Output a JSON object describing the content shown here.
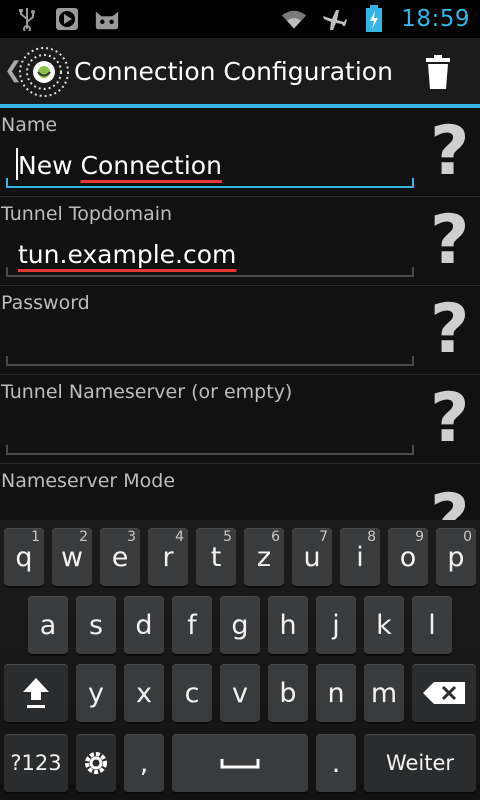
{
  "statusbar": {
    "time": "18:59"
  },
  "actionbar": {
    "title": "Connection Configuration"
  },
  "form": {
    "fields": [
      {
        "label": "Name",
        "value": "New Connection",
        "focused": true
      },
      {
        "label": "Tunnel Topdomain",
        "value": "tun.example.com"
      },
      {
        "label": "Password",
        "value": ""
      },
      {
        "label": "Tunnel Nameserver (or empty)",
        "value": ""
      },
      {
        "label": "Nameserver Mode",
        "value": ""
      }
    ],
    "help_symbol": "?"
  },
  "name_value_parts": {
    "word1": "New",
    "word2": "Connection"
  },
  "keyboard": {
    "row1": [
      {
        "key": "q",
        "hint": "1"
      },
      {
        "key": "w",
        "hint": "2"
      },
      {
        "key": "e",
        "hint": "3"
      },
      {
        "key": "r",
        "hint": "4"
      },
      {
        "key": "t",
        "hint": "5"
      },
      {
        "key": "z",
        "hint": "6"
      },
      {
        "key": "u",
        "hint": "7"
      },
      {
        "key": "i",
        "hint": "8"
      },
      {
        "key": "o",
        "hint": "9"
      },
      {
        "key": "p",
        "hint": "0"
      }
    ],
    "row2": [
      "a",
      "s",
      "d",
      "f",
      "g",
      "h",
      "j",
      "k",
      "l"
    ],
    "row3": [
      "y",
      "x",
      "c",
      "v",
      "b",
      "n",
      "m"
    ],
    "symbols_label": "?123",
    "comma": ",",
    "period": ".",
    "action_label": "Weiter"
  }
}
